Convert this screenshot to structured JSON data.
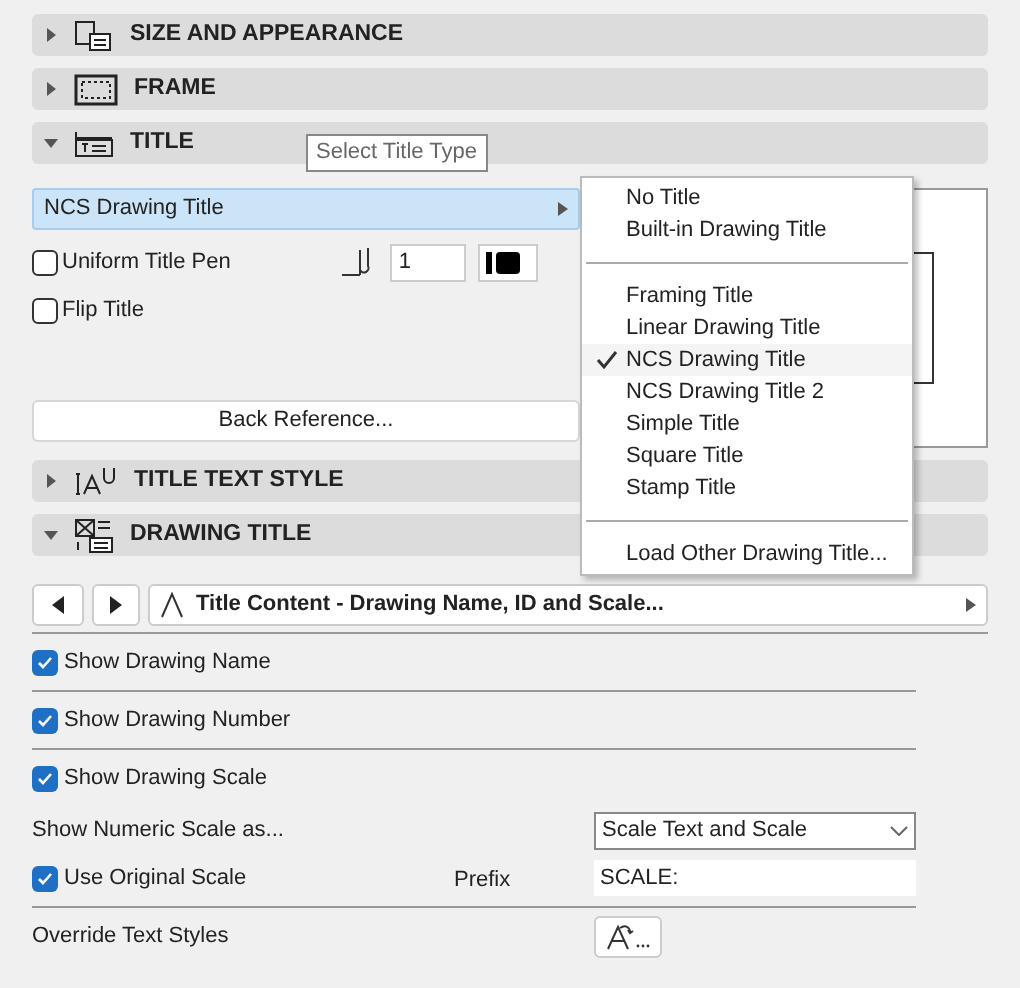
{
  "sections": [
    {
      "kind": "size",
      "title": "SIZE AND APPEARANCE",
      "expanded": false
    },
    {
      "kind": "frame",
      "title": "FRAME",
      "expanded": false
    },
    {
      "kind": "title",
      "title": "TITLE",
      "expanded": true
    },
    {
      "kind": "text_style",
      "title": "TITLE TEXT STYLE",
      "expanded": false
    },
    {
      "kind": "drawing_title",
      "title": "DRAWING TITLE",
      "expanded": true
    }
  ],
  "tooltip": "Select Title Type",
  "title_panel": {
    "title_type": "NCS Drawing Title",
    "uniform_title_pen": {
      "label": "Uniform Title Pen",
      "checked": false
    },
    "pen_number": "1",
    "flip_title": {
      "label": "Flip Title",
      "checked": false
    },
    "back_reference": "Back Reference..."
  },
  "title_menu": {
    "groups": [
      [
        {
          "label": "No Title",
          "selected": false
        },
        {
          "label": "Built-in Drawing Title",
          "selected": false
        }
      ],
      [
        {
          "label": "Framing Title",
          "selected": false
        },
        {
          "label": "Linear Drawing Title",
          "selected": false
        },
        {
          "label": "NCS Drawing Title",
          "selected": true
        },
        {
          "label": "NCS Drawing Title 2",
          "selected": false
        },
        {
          "label": "Simple Title",
          "selected": false
        },
        {
          "label": "Square Title",
          "selected": false
        },
        {
          "label": "Stamp Title",
          "selected": false
        }
      ],
      [
        {
          "label": "Load Other Drawing Title...",
          "selected": false
        }
      ]
    ]
  },
  "drawing_title_panel": {
    "content_selector": "Title Content - Drawing Name, ID and Scale...",
    "options": [
      {
        "label": "Show Drawing Name",
        "checked": true
      },
      {
        "label": "Show Drawing Number",
        "checked": true
      },
      {
        "label": "Show Drawing Scale",
        "checked": true
      }
    ],
    "numeric_scale": {
      "label": "Show Numeric Scale as...",
      "value": "Scale Text and Scale"
    },
    "use_original_scale": {
      "label": "Use Original Scale",
      "checked": true
    },
    "prefix": {
      "label": "Prefix",
      "value": "SCALE:"
    },
    "override_text_styles": "Override Text Styles"
  }
}
